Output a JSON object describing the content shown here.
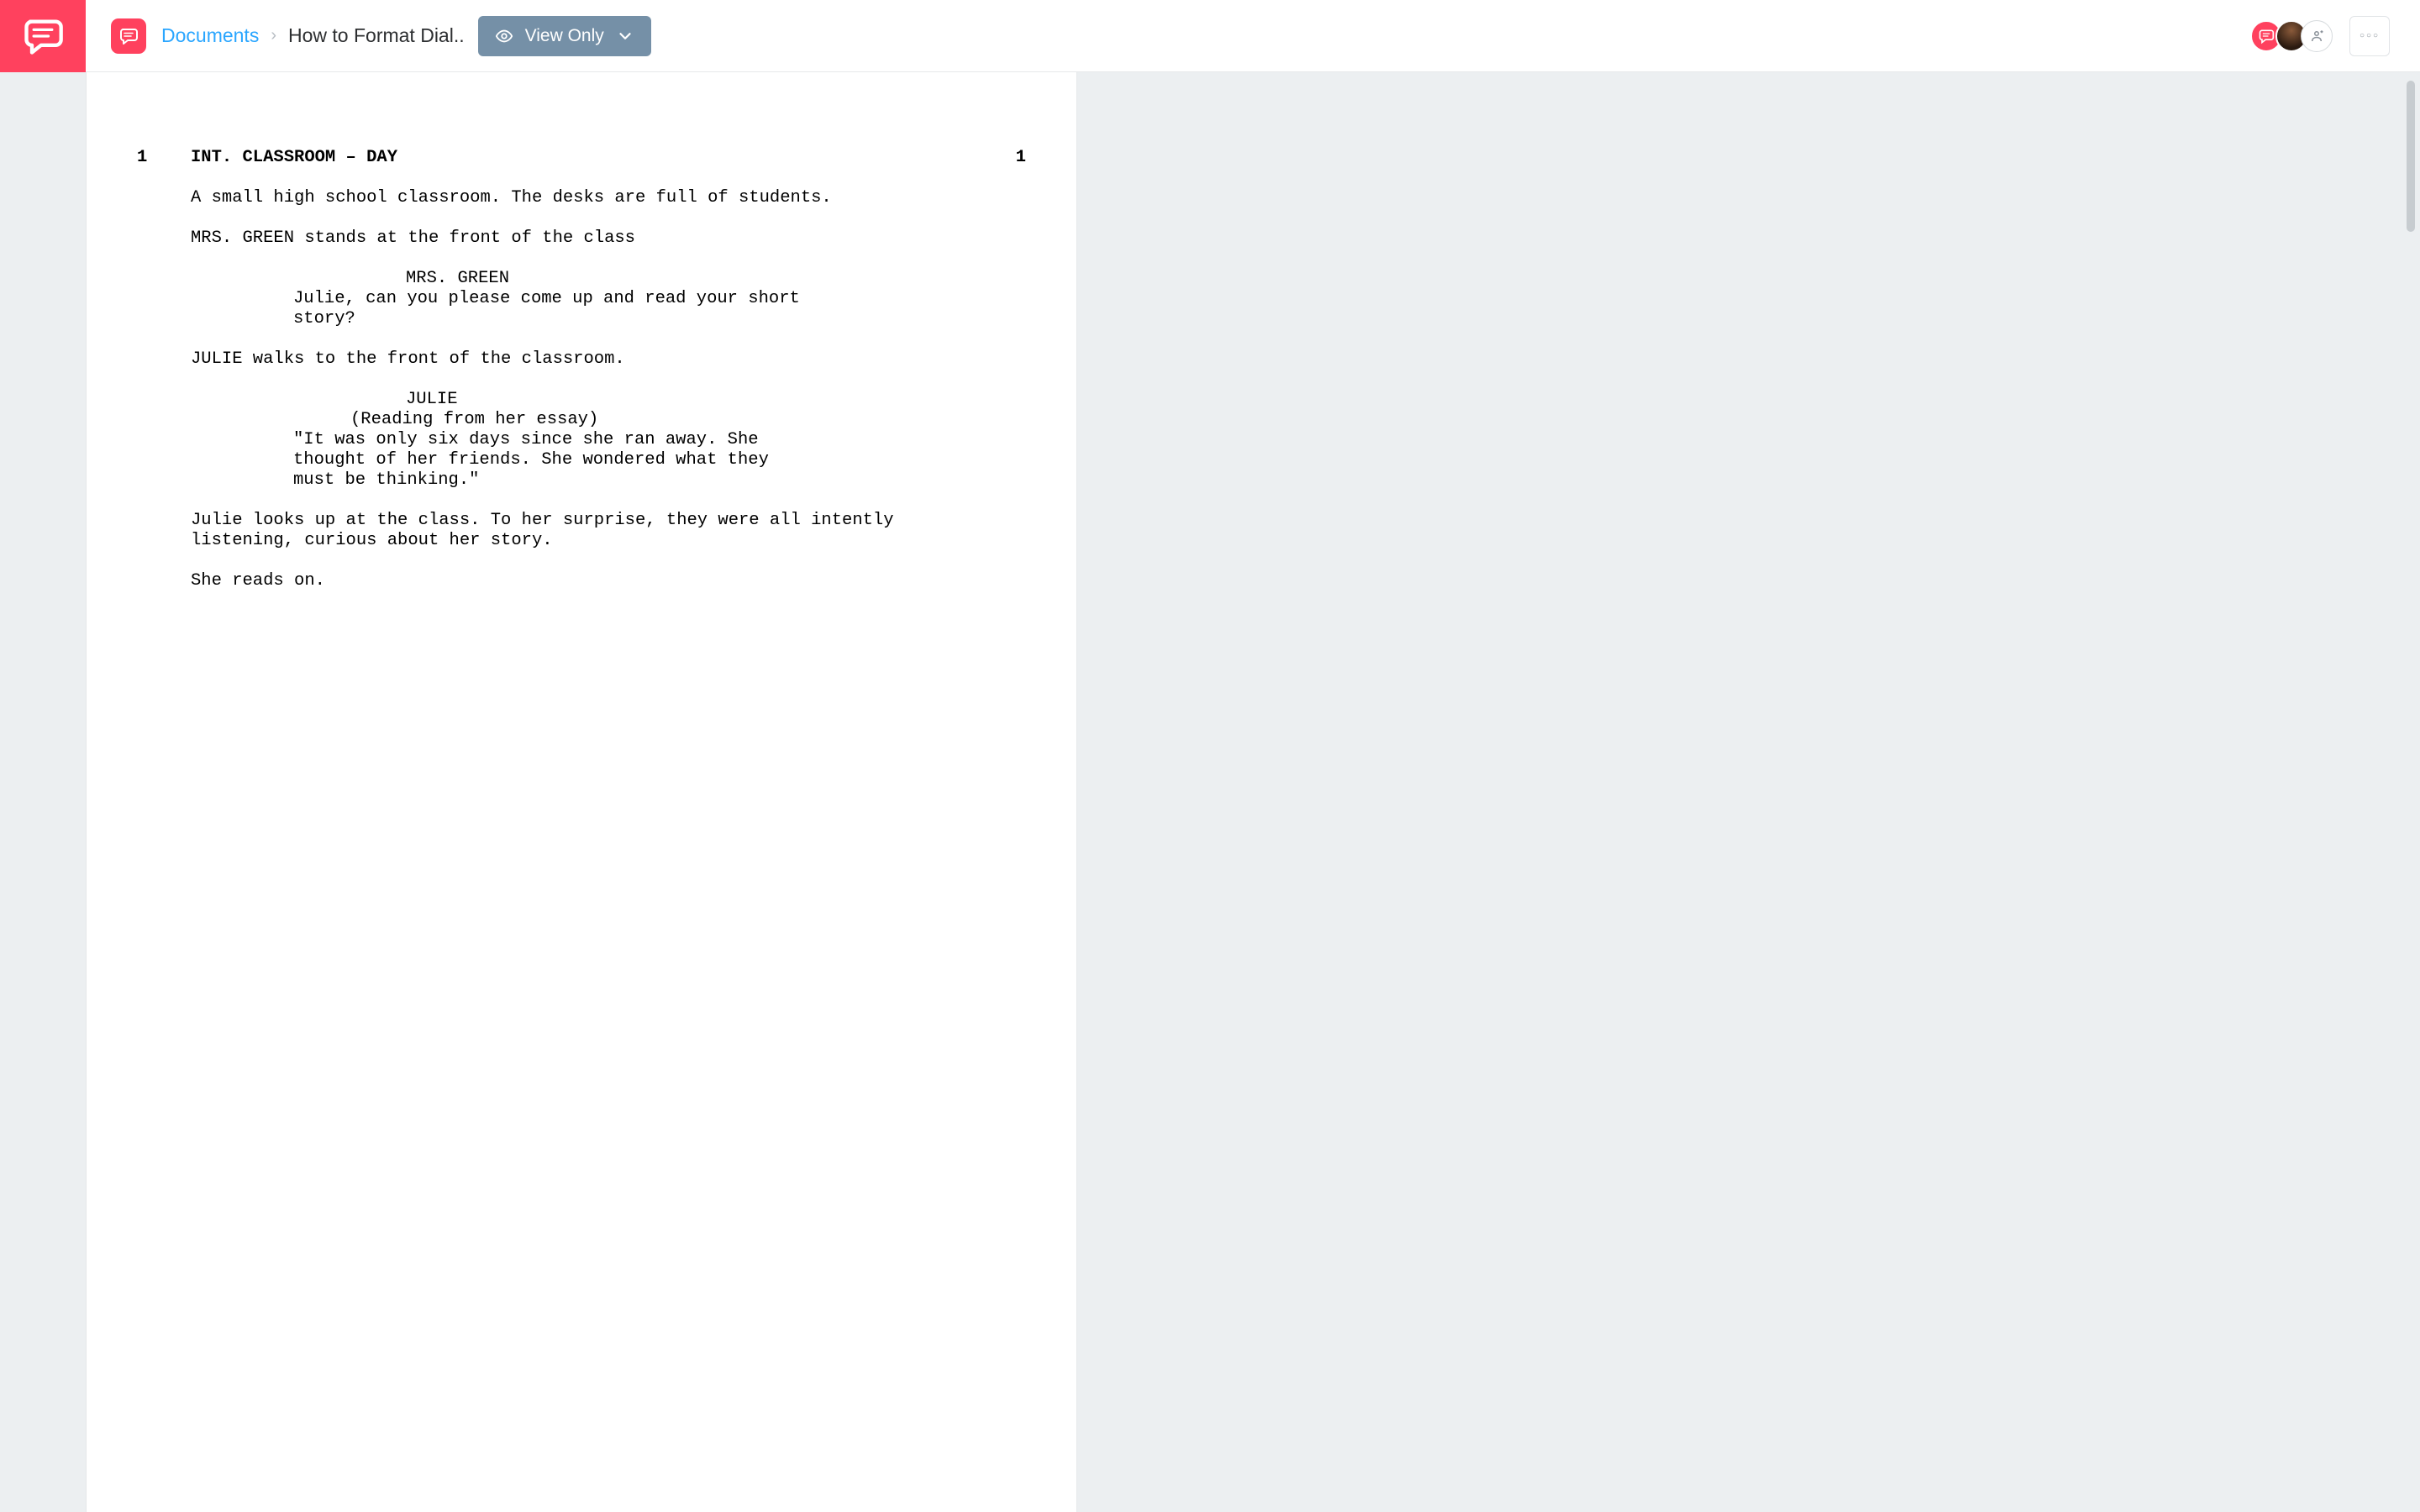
{
  "header": {
    "breadcrumb_root": "Documents",
    "breadcrumb_current": "How to Format Dial..",
    "view_mode_label": "View Only"
  },
  "script": {
    "scene_number_left": "1",
    "scene_number_right": "1",
    "scene_heading": "INT. CLASSROOM – DAY",
    "action_1": "A small high school classroom. The desks are full of students.",
    "action_2": "MRS. GREEN stands at the front of the class",
    "dialogue_1": {
      "character": "MRS. GREEN",
      "speech": "Julie, can you please come up and read your short story?"
    },
    "action_3": "JULIE walks to the front of the classroom.",
    "dialogue_2": {
      "character": "JULIE",
      "paren": "(Reading from her essay)",
      "speech": "\"It was only six days since she ran away. She thought of her friends. She wondered what they must be thinking.\""
    },
    "action_4": "Julie looks up at the class. To her surprise, they were all intently listening, curious about her story.",
    "action_5": "She reads on."
  }
}
